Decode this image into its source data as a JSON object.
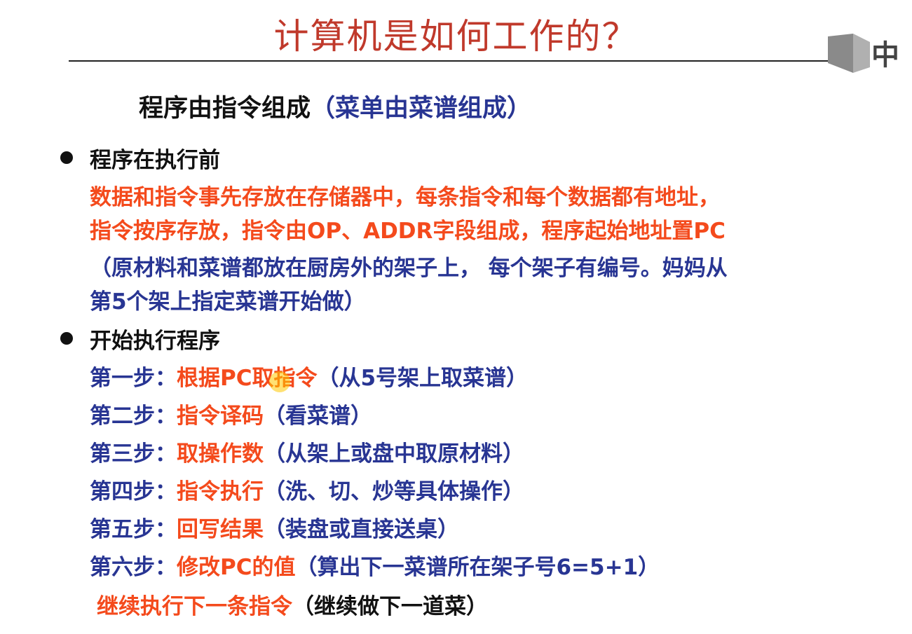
{
  "title": "计算机是如何工作的？",
  "subtitle": {
    "main": "程序由指令组成",
    "paren": "（菜单由菜谱组成）"
  },
  "logo_text": "中",
  "sections": [
    {
      "heading": "程序在执行前",
      "lines": [
        "数据和指令事先存放在存储器中，每条指令和每个数据都有地址，",
        "指令按序存放，指令由OP、ADDR字段组成，程序起始地址置PC"
      ],
      "analogy": [
        "（原材料和菜谱都放在厨房外的架子上， 每个架子有编号。妈妈从",
        "第5个架上指定菜谱开始做）"
      ]
    },
    {
      "heading": "开始执行程序",
      "steps": [
        {
          "label": "第一步：",
          "action": "根据PC取指令",
          "note": "（从5号架上取菜谱）"
        },
        {
          "label": "第二步：",
          "action": "指令译码",
          "note": "（看菜谱）"
        },
        {
          "label": "第三步：",
          "action": "取操作数",
          "note": "（从架上或盘中取原材料）"
        },
        {
          "label": "第四步：",
          "action": "指令执行",
          "note": "（洗、切、炒等具体操作）"
        },
        {
          "label": "第五步：",
          "action": "回写结果",
          "note": "（装盘或直接送桌）"
        },
        {
          "label": "第六步：",
          "action": "修改PC的值",
          "note": "（算出下一菜谱所在架子号6=5+1）"
        }
      ],
      "final": {
        "action": "继续执行下一条指令",
        "note": "（继续做下一道菜）"
      }
    }
  ],
  "colors": {
    "title": "#c0392b",
    "red": "#f44a1c",
    "blue": "#283593",
    "dark": "#111111"
  }
}
